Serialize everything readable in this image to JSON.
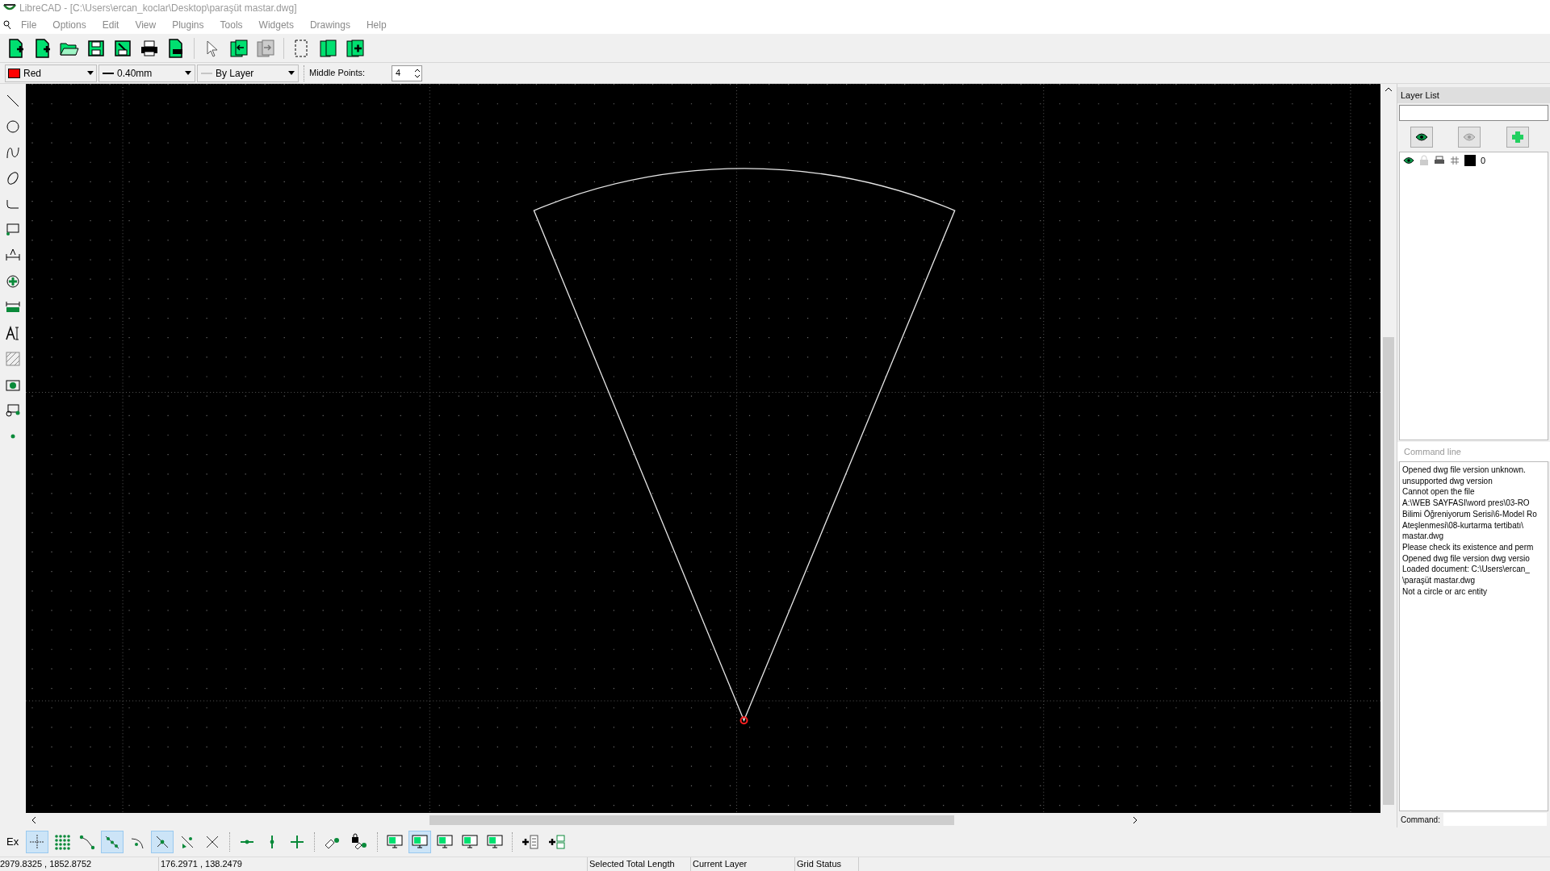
{
  "window": {
    "title": "LibreCAD - [C:\\Users\\ercan_koclar\\Desktop\\paraşüt mastar.dwg]"
  },
  "menu": [
    "File",
    "Options",
    "Edit",
    "View",
    "Plugins",
    "Tools",
    "Widgets",
    "Drawings",
    "Help"
  ],
  "pen_toolbar": {
    "color": {
      "label": "Red",
      "color": "#ff0000"
    },
    "width": "0.40mm",
    "line_type": "By Layer",
    "middle_points": {
      "label": "Middle Points:",
      "value": "4"
    }
  },
  "layer_list": {
    "title": "Layer List",
    "layers": [
      {
        "name": "0",
        "visible": true,
        "locked": false,
        "color": "#000000"
      }
    ]
  },
  "command_line": {
    "title": "Command line",
    "lines": [
      "Opened dwg file version unknown.",
      "unsupported dwg version",
      "Cannot open the file",
      "A:\\WEB SAYFASI\\word pres\\03-RO",
      "Bilimi Öğreniyorum Serisi\\6-Model Ro",
      "Ateşlenmesi\\08-kurtarma tertibatı\\",
      "mastar.dwg",
      "Please check its existence and perm",
      "Opened dwg file version dwg versio",
      "Loaded document: C:\\Users\\ercan_",
      "\\paraşüt mastar.dwg",
      "Not a circle or arc entity"
    ],
    "prompt": "Command:"
  },
  "snap_toolbar": {
    "label": "Ex",
    "snaps": [
      {
        "kind": "free",
        "selected": true
      },
      {
        "kind": "grid",
        "selected": false
      },
      {
        "kind": "endpoint",
        "selected": false
      },
      {
        "kind": "on_entity",
        "selected": true
      },
      {
        "kind": "center",
        "selected": false
      },
      {
        "kind": "middle",
        "selected": true
      },
      {
        "kind": "distance",
        "selected": false
      },
      {
        "kind": "intersection",
        "selected": false
      }
    ],
    "restrictions": [
      {
        "kind": "horizontal",
        "selected": false
      },
      {
        "kind": "vertical",
        "selected": false
      },
      {
        "kind": "orthogonal",
        "selected": false
      }
    ],
    "views": [
      {
        "selected": false
      },
      {
        "selected": true
      },
      {
        "selected": false
      },
      {
        "selected": false
      },
      {
        "selected": false
      }
    ]
  },
  "status_bar": {
    "absolute": "2979.8325 , 1852.8752",
    "relative": "176.2971 , 138.2479",
    "selected_total_length": "Selected Total Length",
    "current_layer": "Current Layer",
    "grid_status": "Grid Status"
  }
}
